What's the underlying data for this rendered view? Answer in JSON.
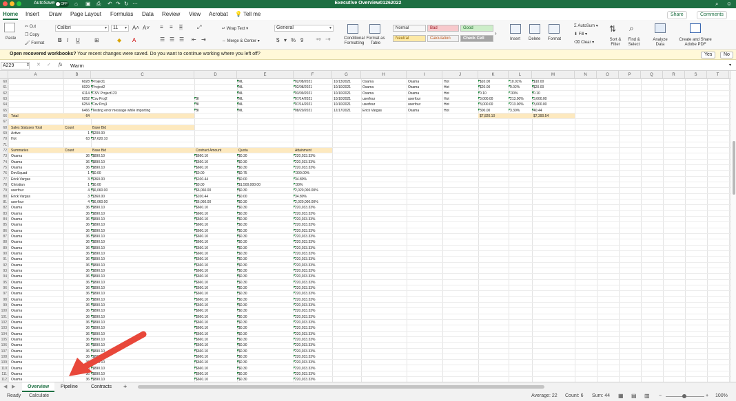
{
  "window": {
    "title": "Executive Overview01262022",
    "autosave_label": "AutoSave",
    "autosave_state": "OFF"
  },
  "ribbon_tabs": [
    "Home",
    "Insert",
    "Draw",
    "Page Layout",
    "Formulas",
    "Data",
    "Review",
    "View",
    "Acrobat"
  ],
  "tell_me": "Tell me",
  "share_label": "Share",
  "comments_label": "Comments",
  "ribbon": {
    "paste": "Paste",
    "cut": "Cut",
    "copy": "Copy",
    "format": "Format",
    "font_name": "Calibri",
    "font_size": "11",
    "wrap_text": "Wrap Text",
    "merge_center": "Merge & Center",
    "number_format": "General",
    "conditional": "Conditional Formatting",
    "format_table": "Format as Table",
    "styles": [
      {
        "label": "Normal",
        "bg": "#ffffff",
        "fg": "#222222"
      },
      {
        "label": "Bad",
        "bg": "#f8c9cc",
        "fg": "#9c1c25"
      },
      {
        "label": "Good",
        "bg": "#cdeec9",
        "fg": "#216c2f"
      },
      {
        "label": "Neutral",
        "bg": "#fde9a6",
        "fg": "#8a6100"
      },
      {
        "label": "Calculation",
        "bg": "#f2f2f2",
        "fg": "#c2581a"
      },
      {
        "label": "Check Cell",
        "bg": "#a5a5a5",
        "fg": "#ffffff"
      }
    ],
    "insert": "Insert",
    "delete": "Delete",
    "format_cells": "Format",
    "autosum": "AutoSum",
    "fill": "Fill",
    "clear": "Clear",
    "sort_filter": "Sort & Filter",
    "find_select": "Find & Select",
    "analyze": "Analyze Data",
    "create_share": "Create and Share Adobe PDF"
  },
  "notification": {
    "title": "Open recovered workbooks?",
    "message": "Your recent changes were saved. Do you want to continue working where you left off?",
    "yes": "Yes",
    "no": "No"
  },
  "formula_bar": {
    "cell_ref": "A229",
    "value": "Warm"
  },
  "columns": [
    "A",
    "B",
    "C",
    "D",
    "E",
    "F",
    "G",
    "H",
    "I",
    "J",
    "K",
    "L",
    "M",
    "N",
    "O",
    "P",
    "Q",
    "R",
    "S",
    "T",
    "U"
  ],
  "top_rows": [
    {
      "n": "60",
      "b": "6028",
      "c": "Project1",
      "e": "ML",
      "f": "02/08/2021",
      "g": "10/13/2021",
      "h": "Osama",
      "i": "Osama",
      "j": "Hot",
      "k": "$10.00",
      "l": "10.01%",
      "m": "$10.00"
    },
    {
      "n": "61",
      "b": "6029",
      "c": "Project2",
      "e": "ML",
      "f": "02/08/2021",
      "g": "10/10/2021",
      "h": "Osama",
      "i": "Osama",
      "j": "Hot",
      "k": "$20.00",
      "l": "0.02%",
      "m": "$20.00"
    },
    {
      "n": "62",
      "b": "6114",
      "c": "CSV Project123",
      "e": "ML",
      "f": "03/09/2021",
      "g": "10/10/2021",
      "h": "Osama",
      "i": "Osama",
      "j": "Hot",
      "k": "0.10",
      "l": ".00%",
      "m": "0.10"
    },
    {
      "n": "63",
      "b": "6252",
      "c": "Csv Proj2",
      "d": "BI",
      "e": "ML",
      "f": "07/14/2021",
      "g": "10/10/2021",
      "h": "userfour",
      "i": "userfour",
      "j": "Hot",
      "k": "3,000.00",
      "l": "213.00%",
      "m": "3,000.00"
    },
    {
      "n": "64",
      "b": "6254",
      "c": "Csv Proj1",
      "d": "BI",
      "e": "ML",
      "f": "07/14/2021",
      "g": "10/10/2021",
      "h": "userfour",
      "i": "userfour",
      "j": "Hot",
      "k": "3,000.00",
      "l": "213.00%",
      "m": "3,000.00"
    },
    {
      "n": "65",
      "b": "6466",
      "c": "Testing error message while importing",
      "d": "BI",
      "e": "ML",
      "f": "08/20/2021",
      "g": "12/17/2021",
      "h": "Erick Vargas",
      "i": "Osama",
      "j": "Hot",
      "k": "300.00",
      "l": "3.30%",
      "m": "40.44"
    }
  ],
  "total_row": {
    "n": "66",
    "a": "Total",
    "b": "64",
    "k": "$7,820.10",
    "m": "$7,390.54"
  },
  "status_table": {
    "header": {
      "n": "68",
      "a": "Sales Statuses Total",
      "b": "Count",
      "c": "Base Bid"
    },
    "rows": [
      {
        "n": "69",
        "a": "Active",
        "b": "1",
        "c": "$200.00"
      },
      {
        "n": "70",
        "a": "Hot",
        "b": "63",
        "c": "$7,620.10"
      }
    ]
  },
  "summary_header": {
    "n": "72",
    "a": "Summaries",
    "b": "Count",
    "c": "Base Bid",
    "d": "Contract Amount",
    "e": "Quota",
    "f": "Attainment"
  },
  "summary_rows": [
    {
      "n": "73",
      "a": "Osama",
      "b": "36",
      "c": "$890.10",
      "d": "$660.10",
      "e": "$0.30",
      "f": "220,033.33%"
    },
    {
      "n": "74",
      "a": "Osama",
      "b": "36",
      "c": "$890.10",
      "d": "$660.10",
      "e": "$0.30",
      "f": "220,033.33%"
    },
    {
      "n": "75",
      "a": "Osama",
      "b": "36",
      "c": "$890.10",
      "d": "$660.10",
      "e": "$0.30",
      "f": "220,033.33%"
    },
    {
      "n": "76",
      "a": "DevSquad",
      "b": "1",
      "c": "$0.00",
      "d": "$0.00",
      "e": "$0.75",
      "f": ".000.00%"
    },
    {
      "n": "77",
      "a": "Erick Vargas",
      "b": "3",
      "c": "$360.00",
      "d": "$100.44",
      "e": "$0.00",
      "f": "34.80%"
    },
    {
      "n": "78",
      "a": "Christian",
      "b": "1",
      "c": "$0.00",
      "d": "$0.00",
      "e": "$1,500,000.00",
      "f": ".00%"
    },
    {
      "n": "79",
      "a": "userfour",
      "b": "4",
      "c": "$6,060.00",
      "d": "$6,060.00",
      "e": "$0.30",
      "f": "2,020,000.00%"
    },
    {
      "n": "80",
      "a": "Erick Vargas",
      "b": "3",
      "c": "$360.00",
      "d": "$100.44",
      "e": "$0.00",
      "f": "34.80%"
    },
    {
      "n": "81",
      "a": "userfour",
      "b": "4",
      "c": "$6,060.00",
      "d": "$6,060.00",
      "e": "$0.30",
      "f": "2,020,000.00%"
    },
    {
      "n": "82",
      "a": "Osama",
      "b": "36",
      "c": "$890.10",
      "d": "$660.10",
      "e": "$0.30",
      "f": "220,033.33%"
    },
    {
      "n": "83",
      "a": "Osama",
      "b": "36",
      "c": "$890.10",
      "d": "$660.10",
      "e": "$0.30",
      "f": "220,033.33%"
    },
    {
      "n": "84",
      "a": "Osama",
      "b": "36",
      "c": "$890.10",
      "d": "$660.10",
      "e": "$0.30",
      "f": "220,033.33%"
    },
    {
      "n": "85",
      "a": "Osama",
      "b": "36",
      "c": "$890.10",
      "d": "$660.10",
      "e": "$0.30",
      "f": "220,033.33%"
    },
    {
      "n": "86",
      "a": "Osama",
      "b": "36",
      "c": "$890.10",
      "d": "$660.10",
      "e": "$0.30",
      "f": "220,033.33%"
    },
    {
      "n": "87",
      "a": "Osama",
      "b": "36",
      "c": "$890.10",
      "d": "$660.10",
      "e": "$0.30",
      "f": "220,033.33%"
    },
    {
      "n": "88",
      "a": "Osama",
      "b": "36",
      "c": "$890.10",
      "d": "$660.10",
      "e": "$0.30",
      "f": "220,033.33%"
    },
    {
      "n": "89",
      "a": "Osama",
      "b": "36",
      "c": "$890.10",
      "d": "$660.10",
      "e": "$0.30",
      "f": "220,033.33%"
    },
    {
      "n": "90",
      "a": "Osama",
      "b": "36",
      "c": "$890.10",
      "d": "$660.10",
      "e": "$0.30",
      "f": "220,033.33%"
    },
    {
      "n": "91",
      "a": "Osama",
      "b": "36",
      "c": "$890.10",
      "d": "$660.10",
      "e": "$0.30",
      "f": "220,033.33%"
    },
    {
      "n": "92",
      "a": "Osama",
      "b": "36",
      "c": "$890.10",
      "d": "$660.10",
      "e": "$0.30",
      "f": "220,033.33%"
    },
    {
      "n": "93",
      "a": "Osama",
      "b": "36",
      "c": "$890.10",
      "d": "$660.10",
      "e": "$0.30",
      "f": "220,033.33%"
    },
    {
      "n": "94",
      "a": "Osama",
      "b": "36",
      "c": "$890.10",
      "d": "$660.10",
      "e": "$0.30",
      "f": "220,033.33%"
    },
    {
      "n": "95",
      "a": "Osama",
      "b": "36",
      "c": "$890.10",
      "d": "$660.10",
      "e": "$0.30",
      "f": "220,033.33%"
    },
    {
      "n": "96",
      "a": "Osama",
      "b": "36",
      "c": "$890.10",
      "d": "$660.10",
      "e": "$0.30",
      "f": "220,033.33%"
    },
    {
      "n": "97",
      "a": "Osama",
      "b": "36",
      "c": "$890.10",
      "d": "$660.10",
      "e": "$0.30",
      "f": "220,033.33%"
    },
    {
      "n": "98",
      "a": "Osama",
      "b": "36",
      "c": "$890.10",
      "d": "$660.10",
      "e": "$0.30",
      "f": "220,033.33%"
    },
    {
      "n": "99",
      "a": "Osama",
      "b": "36",
      "c": "$890.10",
      "d": "$660.10",
      "e": "$0.30",
      "f": "220,033.33%"
    },
    {
      "n": "100",
      "a": "Osama",
      "b": "36",
      "c": "$890.10",
      "d": "$660.10",
      "e": "$0.30",
      "f": "220,033.33%"
    },
    {
      "n": "101",
      "a": "Osama",
      "b": "36",
      "c": "$890.10",
      "d": "$660.10",
      "e": "$0.30",
      "f": "220,033.33%"
    },
    {
      "n": "102",
      "a": "Osama",
      "b": "36",
      "c": "$890.10",
      "d": "$660.10",
      "e": "$0.30",
      "f": "220,033.33%"
    },
    {
      "n": "103",
      "a": "Osama",
      "b": "36",
      "c": "$890.10",
      "d": "$660.10",
      "e": "$0.30",
      "f": "220,033.33%"
    },
    {
      "n": "104",
      "a": "Osama",
      "b": "36",
      "c": "$890.10",
      "d": "$660.10",
      "e": "$0.30",
      "f": "220,033.33%"
    },
    {
      "n": "105",
      "a": "Osama",
      "b": "36",
      "c": "$890.10",
      "d": "$660.10",
      "e": "$0.30",
      "f": "220,033.33%"
    },
    {
      "n": "106",
      "a": "Osama",
      "b": "36",
      "c": "$890.10",
      "d": "$660.10",
      "e": "$0.30",
      "f": "220,033.33%"
    },
    {
      "n": "107",
      "a": "Osama",
      "b": "36",
      "c": "$890.10",
      "d": "$660.10",
      "e": "$0.30",
      "f": "220,033.33%"
    },
    {
      "n": "108",
      "a": "Osama",
      "b": "36",
      "c": "$890.10",
      "d": "$660.10",
      "e": "$0.30",
      "f": "220,033.33%"
    },
    {
      "n": "109",
      "a": "Osama",
      "b": "36",
      "c": "$890.10",
      "d": "$660.10",
      "e": "$0.30",
      "f": "220,033.33%"
    },
    {
      "n": "110",
      "a": "Osama",
      "b": "36",
      "c": "$890.10",
      "d": "$660.10",
      "e": "$0.30",
      "f": "220,033.33%"
    },
    {
      "n": "111",
      "a": "Osama",
      "b": "36",
      "c": "$890.10",
      "d": "$660.10",
      "e": "$0.30",
      "f": "220,033.33%"
    },
    {
      "n": "112",
      "a": "Osama",
      "b": "36",
      "c": "$890.10",
      "d": "$660.10",
      "e": "$0.30",
      "f": "220,033.33%"
    }
  ],
  "sheet_tabs": [
    "Overview",
    "Pipeline",
    "Contracts"
  ],
  "active_sheet": "Overview",
  "status_bar": {
    "ready": "Ready",
    "calculate": "Calculate",
    "average": "Average: 22",
    "count": "Count: 6",
    "sum": "Sum: 44",
    "zoom": "100%"
  },
  "annotation": {
    "arrow_color": "#e8473a",
    "points_to": "pipeline-tab"
  },
  "colors": {
    "brand": "#1d6f42",
    "highlight": "#fde9bf",
    "notification_bg": "#fff8d8"
  }
}
